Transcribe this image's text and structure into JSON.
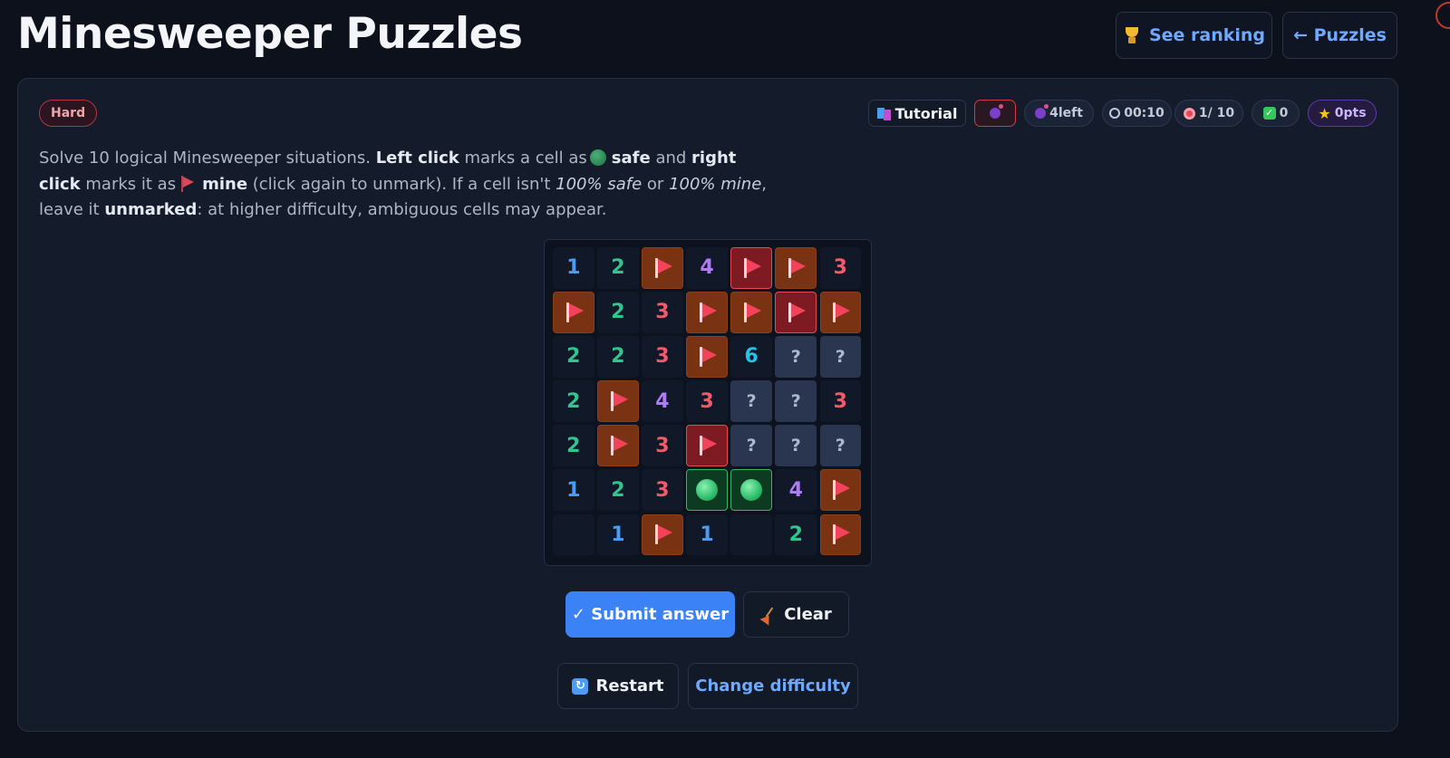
{
  "header": {
    "title": "Minesweeper Puzzles",
    "ranking_label": "See ranking",
    "puzzles_label": "← Puzzles"
  },
  "status": {
    "difficulty": "Hard",
    "tutorial_label": "Tutorial",
    "mines_left": "4left",
    "timer": "00:10",
    "progress": "1/ 10",
    "correct": "0",
    "points": "0pts"
  },
  "instructions": {
    "p1": "Solve 10 logical Minesweeper situations.",
    "left_click": "Left click",
    "p2": "marks a cell as",
    "safe": "safe",
    "p3": "and",
    "right_click": "right click",
    "p4": "marks it as",
    "mine": "mine",
    "p5": "(click again to unmark). If a cell isn't",
    "safe100": "100% safe",
    "p6": "or",
    "mine100": "100% mine",
    "p7": ", leave it",
    "unmarked": "unmarked",
    "p8": ": at higher difficulty, ambiguous cells may appear."
  },
  "board": {
    "rows": [
      [
        {
          "t": "num",
          "v": "1"
        },
        {
          "t": "num",
          "v": "2"
        },
        {
          "t": "flag"
        },
        {
          "t": "num",
          "v": "4"
        },
        {
          "t": "flag",
          "wrong": true
        },
        {
          "t": "flag"
        },
        {
          "t": "num",
          "v": "3"
        }
      ],
      [
        {
          "t": "flag"
        },
        {
          "t": "num",
          "v": "2"
        },
        {
          "t": "num",
          "v": "3"
        },
        {
          "t": "flag"
        },
        {
          "t": "flag"
        },
        {
          "t": "flag",
          "wrong": true
        },
        {
          "t": "flag"
        }
      ],
      [
        {
          "t": "num",
          "v": "2"
        },
        {
          "t": "num",
          "v": "2"
        },
        {
          "t": "num",
          "v": "3"
        },
        {
          "t": "flag"
        },
        {
          "t": "num",
          "v": "6"
        },
        {
          "t": "unknown",
          "v": "?"
        },
        {
          "t": "unknown",
          "v": "?"
        }
      ],
      [
        {
          "t": "num",
          "v": "2"
        },
        {
          "t": "flag"
        },
        {
          "t": "num",
          "v": "4"
        },
        {
          "t": "num",
          "v": "3"
        },
        {
          "t": "unknown",
          "v": "?"
        },
        {
          "t": "unknown",
          "v": "?"
        },
        {
          "t": "num",
          "v": "3"
        }
      ],
      [
        {
          "t": "num",
          "v": "2"
        },
        {
          "t": "flag"
        },
        {
          "t": "num",
          "v": "3"
        },
        {
          "t": "flag",
          "wrong": true
        },
        {
          "t": "unknown",
          "v": "?"
        },
        {
          "t": "unknown",
          "v": "?"
        },
        {
          "t": "unknown",
          "v": "?"
        }
      ],
      [
        {
          "t": "num",
          "v": "1"
        },
        {
          "t": "num",
          "v": "2"
        },
        {
          "t": "num",
          "v": "3"
        },
        {
          "t": "safe"
        },
        {
          "t": "safe"
        },
        {
          "t": "num",
          "v": "4"
        },
        {
          "t": "flag"
        }
      ],
      [
        {
          "t": "empty"
        },
        {
          "t": "num",
          "v": "1"
        },
        {
          "t": "flag"
        },
        {
          "t": "num",
          "v": "1"
        },
        {
          "t": "empty"
        },
        {
          "t": "num",
          "v": "2"
        },
        {
          "t": "flag"
        }
      ]
    ]
  },
  "actions": {
    "submit_label": "✓ Submit answer",
    "clear_label": "Clear",
    "restart_label": "Restart",
    "change_difficulty_label": "Change difficulty"
  },
  "colors": {
    "background": "#0c111c",
    "panel": "#141c2b",
    "accent": "#3b82f6",
    "flag_cell": "#7a3312",
    "wrong_flag_border": "#e34a55",
    "safe_cell_border": "#2fb866",
    "unknown_cell": "#2a3650"
  }
}
